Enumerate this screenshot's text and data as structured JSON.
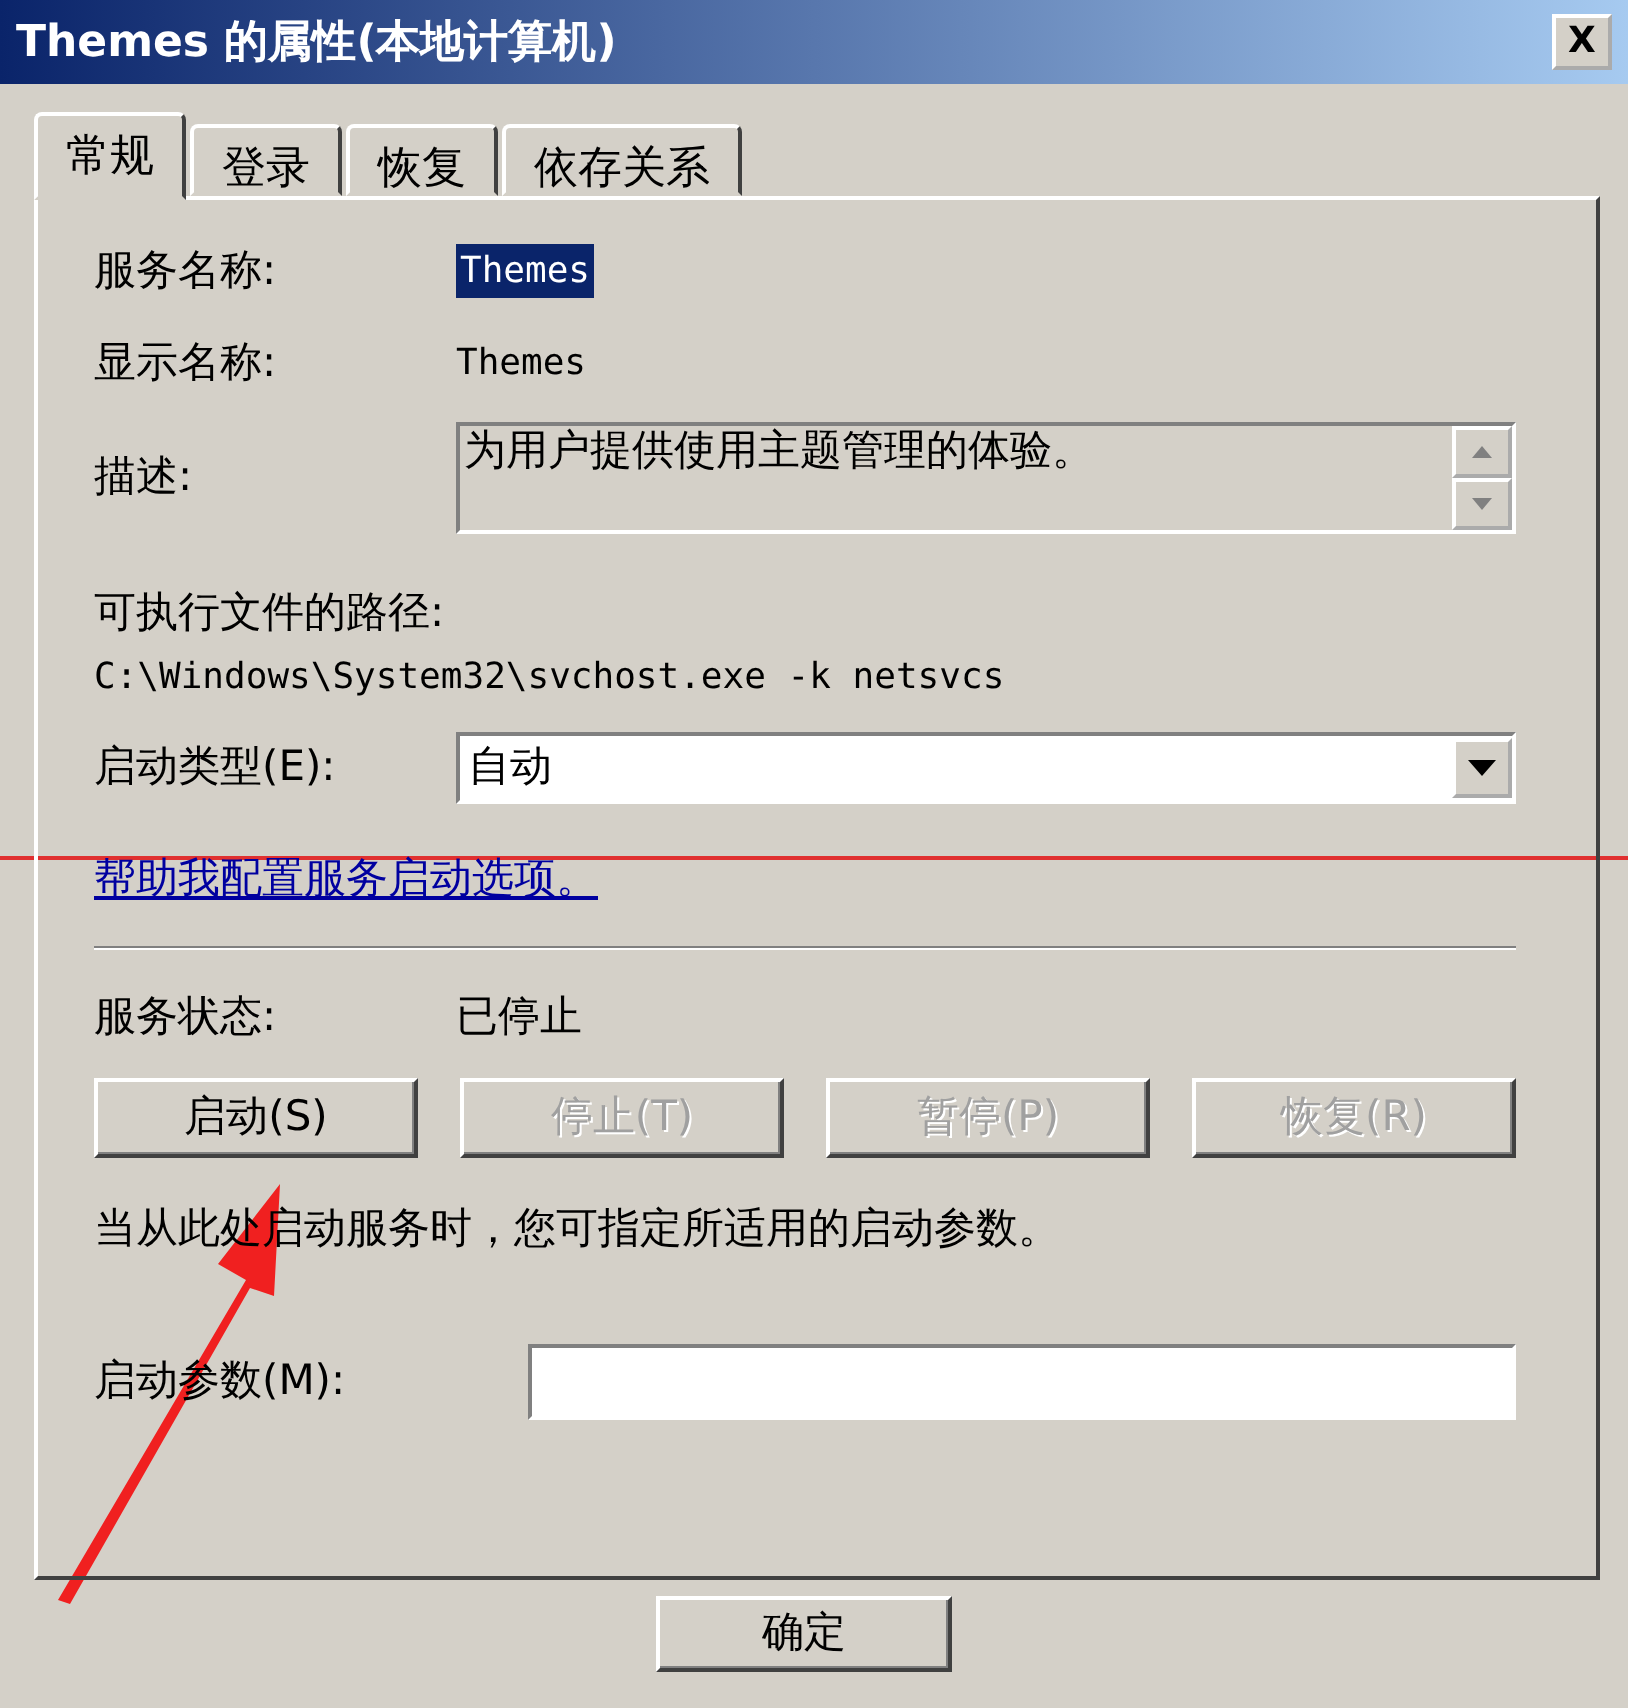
{
  "window": {
    "title": "Themes 的属性(本地计算机)",
    "close": "X"
  },
  "tabs": [
    {
      "label": "常规",
      "selected": true
    },
    {
      "label": "登录",
      "selected": false
    },
    {
      "label": "恢复",
      "selected": false
    },
    {
      "label": "依存关系",
      "selected": false
    }
  ],
  "service_name": {
    "label": "服务名称:",
    "value": "Themes",
    "highlighted": true
  },
  "display_name": {
    "label": "显示名称:",
    "value": "Themes"
  },
  "description": {
    "label": "描述:",
    "value": "为用户提供使用主题管理的体验。"
  },
  "executable_path": {
    "label": "可执行文件的路径:",
    "value": "C:\\Windows\\System32\\svchost.exe -k netsvcs"
  },
  "startup_type": {
    "label": "启动类型(E):",
    "value": "自动"
  },
  "help_link": "帮助我配置服务启动选项。",
  "service_status": {
    "label": "服务状态:",
    "value": "已停止"
  },
  "service_buttons": [
    {
      "label": "启动(S)",
      "disabled": false
    },
    {
      "label": "停止(T)",
      "disabled": true
    },
    {
      "label": "暂停(P)",
      "disabled": true
    },
    {
      "label": "恢复(R)",
      "disabled": true
    }
  ],
  "hint": "当从此处启动服务时，您可指定所适用的启动参数。",
  "start_parameters": {
    "label": "启动参数(M):"
  },
  "dialog_buttons": [
    {
      "label": "确定"
    }
  ]
}
